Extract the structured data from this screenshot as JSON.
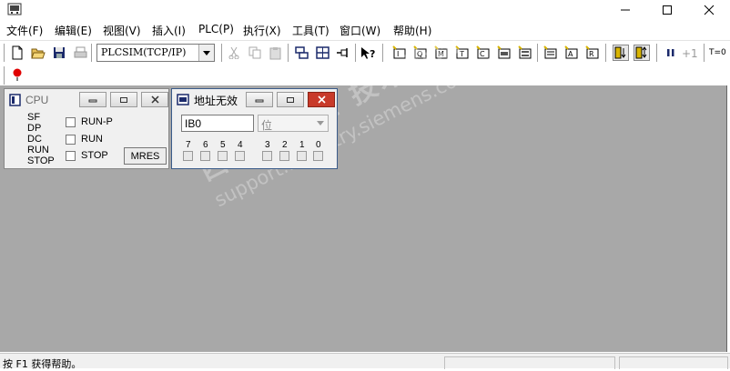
{
  "menu": [
    "文件(F)",
    "编辑(E)",
    "视图(V)",
    "插入(I)",
    "PLC(P)",
    "执行(X)",
    "工具(T)",
    "窗口(W)",
    "帮助(H)"
  ],
  "toolbar": {
    "connection": "PLCSIM(TCP/IP)",
    "step_label": "+1",
    "timer_label": "T=0"
  },
  "cpu_window": {
    "title": "CPU",
    "leds": [
      "SF",
      "DP",
      "DC",
      "RUN",
      "STOP"
    ],
    "modes": [
      "RUN-P",
      "RUN",
      "STOP"
    ],
    "mres_button": "MRES"
  },
  "ib_window": {
    "title": "地址无效",
    "address_value": "IB0",
    "format_value": "位",
    "bits": [
      "7",
      "6",
      "5",
      "4",
      "3",
      "2",
      "1",
      "0"
    ]
  },
  "statusbar": {
    "help_text": "按 F1 获得帮助。"
  },
  "watermark": {
    "line1": "西门子工业 技术论坛",
    "line2": "support.industry.siemens.com/cs"
  },
  "colors": {
    "workspace": "#a8a8a8",
    "close_red": "#c83a2a",
    "inactive_title": "#6d6d6d"
  }
}
